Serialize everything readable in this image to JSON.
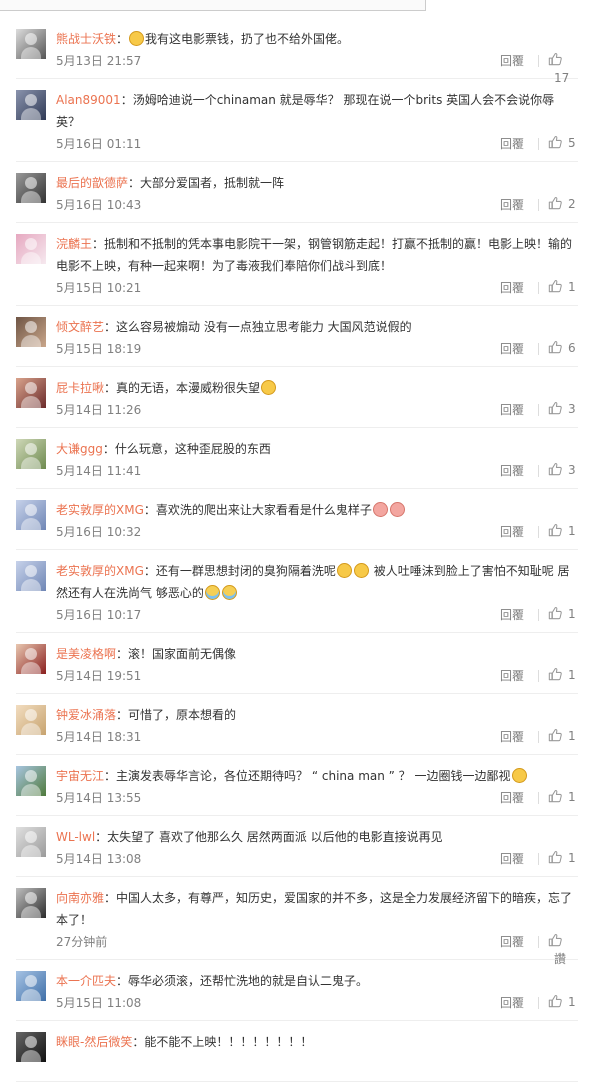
{
  "comments": [
    {
      "name": "熊战士沃铁",
      "pre": "",
      "emoji": [
        "smile"
      ],
      "text": "我有这电影票钱，扔了也不给外国佬。",
      "time": "5月13日 21:57",
      "reply": "回覆",
      "likes": "17",
      "av": [
        "#555",
        "#ddd"
      ]
    },
    {
      "name": "Alan89001",
      "pre": "",
      "emoji": [],
      "text": "汤姆哈迪说一个chinaman 就是辱华？ 那现在说一个brits 英国人会不会说你辱英？",
      "time": "5月16日 01:11",
      "reply": "回覆",
      "likes": "5",
      "av": [
        "#2f3a55",
        "#8a93ad"
      ]
    },
    {
      "name": "最后的歆德萨",
      "pre": "",
      "emoji": [],
      "text": "大部分爱国者，抵制就一阵",
      "time": "5月16日 10:43",
      "reply": "回覆",
      "likes": "2",
      "av": [
        "#333",
        "#999"
      ]
    },
    {
      "name": "浣麟王",
      "pre": "",
      "emoji": [],
      "text": "抵制和不抵制的凭本事电影院干一架，钢管钢筋走起！打赢不抵制的赢！电影上映！输的电影不上映，有种一起来啊！为了毒液我们奉陪你们战斗到底！",
      "time": "5月15日 10:21",
      "reply": "回覆",
      "likes": "1",
      "av": [
        "#f6e9ef",
        "#e6a8c0"
      ]
    },
    {
      "name": "倾文醉艺",
      "pre": "",
      "emoji": [],
      "text": "这么容易被煽动 没有一点独立思考能力 大国风范说假的",
      "time": "5月15日 18:19",
      "reply": "回覆",
      "likes": "6",
      "av": [
        "#c9a68a",
        "#6f5545"
      ]
    },
    {
      "name": "屁卡拉啾",
      "pre": "真的无语，本漫威粉很失望",
      "emoji": [
        "smile"
      ],
      "text": "",
      "time": "5月14日 11:26",
      "reply": "回覆",
      "likes": "3",
      "av": [
        "#6b2b2b",
        "#d9a38c"
      ]
    },
    {
      "name": "大谦ggg",
      "pre": "",
      "emoji": [],
      "text": "什么玩意，这种歪屁股的东西",
      "time": "5月14日 11:41",
      "reply": "回覆",
      "likes": "3",
      "av": [
        "#6e8a4f",
        "#cfd8b8"
      ]
    },
    {
      "name": "老实敦厚的XMG",
      "pre": "喜欢洗的爬出来让大家看看是什么鬼样子",
      "emoji": [
        "pink",
        "pink"
      ],
      "text": "",
      "time": "5月16日 10:32",
      "reply": "回覆",
      "likes": "1",
      "av": [
        "#6f86b5",
        "#c7d2ea"
      ]
    },
    {
      "name": "老实敦厚的XMG",
      "pre": "还有一群思想封闭的臭狗隔着洗呢",
      "emoji": [
        "smile",
        "smile"
      ],
      "text": " 被人吐唾沫到脸上了害怕不知耻呢 居然还有人在洗尚气 够恶心的",
      "emoji2": [
        "tear",
        "tear"
      ],
      "time": "5月16日 10:17",
      "reply": "回覆",
      "likes": "1",
      "av": [
        "#6f86b5",
        "#c7d2ea"
      ]
    },
    {
      "name": "是美凌格啊",
      "pre": "",
      "emoji": [],
      "text": "滚！国家面前无偶像",
      "time": "5月14日 19:51",
      "reply": "回覆",
      "likes": "1",
      "av": [
        "#8a1f1f",
        "#e8c7b0"
      ]
    },
    {
      "name": "钟爱冰涌落",
      "pre": "",
      "emoji": [],
      "text": "可惜了，原本想看的",
      "time": "5月14日 18:31",
      "reply": "回覆",
      "likes": "1",
      "av": [
        "#c7a36f",
        "#f2ddc0"
      ]
    },
    {
      "name": "宇宙无江",
      "pre": "主演发表辱华言论，各位还期待吗？ “ china man ” ？ 一边圈钱一边鄙视",
      "emoji": [
        "smile"
      ],
      "text": "",
      "time": "5月14日 13:55",
      "reply": "回覆",
      "likes": "1",
      "av": [
        "#4f7a3c",
        "#a7c5e0"
      ]
    },
    {
      "name": "WL-lwl",
      "pre": "",
      "emoji": [],
      "text": "太失望了 喜欢了他那么久 居然两面派 以后他的电影直接说再见",
      "time": "5月14日 13:08",
      "reply": "回覆",
      "likes": "1",
      "av": [
        "#9a9a9a",
        "#e0e0e0"
      ]
    },
    {
      "name": "向南亦雅",
      "pre": "",
      "emoji": [],
      "text": "中国人太多，有尊严，知历史，爱国家的并不多，这是全力发展经济留下的暗疾，忘了本了！",
      "time": "27分钟前",
      "reply": "回覆",
      "likes": "讚",
      "av": [
        "#2c2c2c",
        "#bfbfbf"
      ]
    },
    {
      "name": "本一介匹夫",
      "pre": "",
      "emoji": [],
      "text": "辱华必须滚，还帮忙洗地的就是自认二鬼子。",
      "time": "5月15日 11:08",
      "reply": "回覆",
      "likes": "1",
      "av": [
        "#3f6fa8",
        "#a6c3e4"
      ]
    },
    {
      "name": "眯眼-然后微笑",
      "pre": "",
      "emoji": [],
      "text": "能不能不上映！！！！！！！！",
      "time": "",
      "reply": "",
      "likes": "",
      "av": [
        "#111",
        "#666"
      ]
    }
  ]
}
